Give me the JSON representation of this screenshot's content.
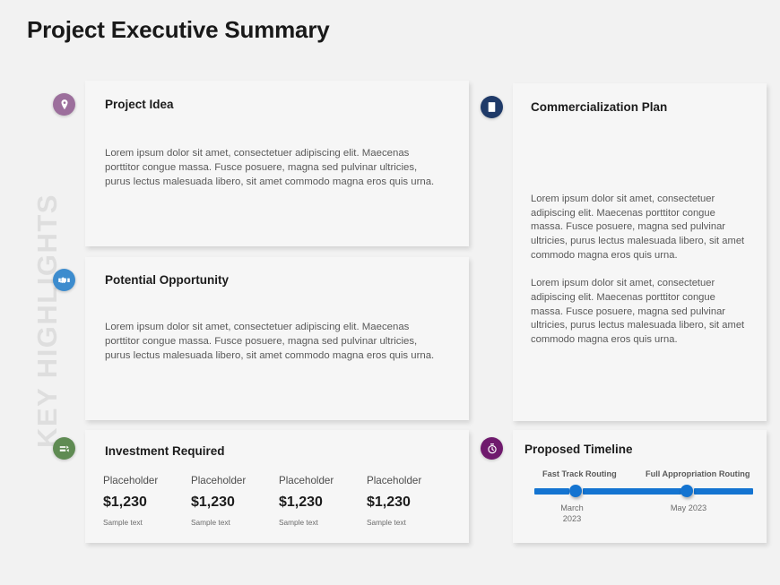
{
  "slide": {
    "title": "Project Executive Summary",
    "side_label": "KEY HIGHLIGHTS",
    "background_color": "#f2f2f2",
    "card_background_color": "#f6f6f6"
  },
  "cards": {
    "project_idea": {
      "title": "Project Idea",
      "body": "Lorem ipsum dolor sit amet, consectetuer adipiscing elit. Maecenas porttitor congue massa. Fusce posuere, magna sed pulvinar ultricies, purus lectus malesuada libero, sit amet commodo magna eros quis urna.",
      "icon": "map-pin-icon",
      "icon_color": "#9c6f9c"
    },
    "potential_opportunity": {
      "title": "Potential Opportunity",
      "body": "Lorem ipsum dolor sit amet, consectetuer adipiscing elit. Maecenas porttitor congue massa. Fusce posuere, magna sed pulvinar ultricies, purus lectus malesuada libero, sit amet commodo magna eros quis urna.",
      "icon": "handshake-icon",
      "icon_color": "#3d8cce"
    },
    "investment_required": {
      "title": "Investment Required",
      "icon": "money-exchange-icon",
      "icon_color": "#5f8b53",
      "columns": [
        {
          "label": "Placeholder",
          "amount": "$1,230",
          "note": "Sample text"
        },
        {
          "label": "Placeholder",
          "amount": "$1,230",
          "note": "Sample text"
        },
        {
          "label": "Placeholder",
          "amount": "$1,230",
          "note": "Sample text"
        },
        {
          "label": "Placeholder",
          "amount": "$1,230",
          "note": "Sample text"
        }
      ]
    },
    "commercialization_plan": {
      "title": "Commercialization Plan",
      "icon": "document-list-icon",
      "icon_color": "#1f3a68",
      "paragraphs": [
        "Lorem ipsum dolor sit amet, consectetuer adipiscing elit. Maecenas porttitor congue massa. Fusce posuere, magna sed pulvinar ultricies, purus lectus malesuada libero, sit amet commodo magna eros quis urna.",
        "Lorem ipsum dolor sit amet, consectetuer adipiscing elit. Maecenas porttitor congue massa. Fusce posuere, magna sed pulvinar ultricies, purus lectus malesuada libero, sit amet commodo magna eros quis urna."
      ]
    },
    "proposed_timeline": {
      "title": "Proposed Timeline",
      "icon": "stopwatch-icon",
      "icon_color": "#6f1a6d",
      "bar_color": "#1474d1",
      "milestones": [
        {
          "label": "Fast Track Routing",
          "date": "March 2023"
        },
        {
          "label": "Full Appropriation Routing",
          "date": "May 2023"
        }
      ]
    }
  }
}
